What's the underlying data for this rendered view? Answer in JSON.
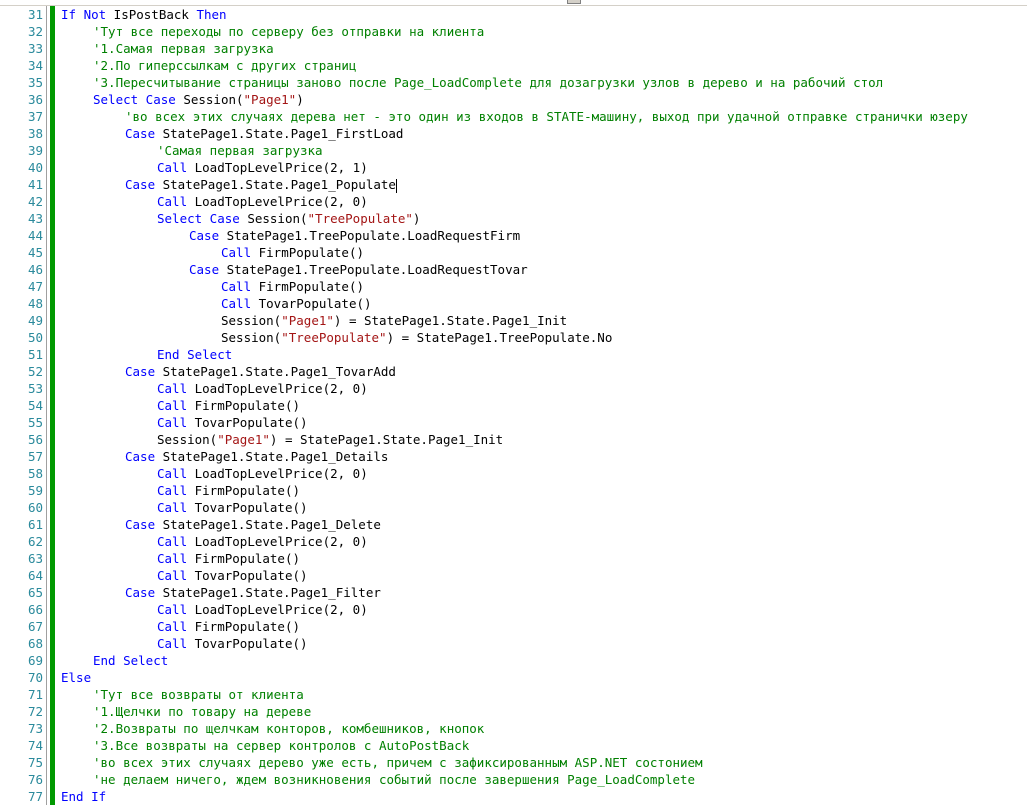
{
  "editor": {
    "lines": [
      {
        "n": "31",
        "indent": 0,
        "tokens": [
          {
            "t": "kw",
            "v": "If Not"
          },
          {
            "t": "tx",
            "v": " IsPostBack "
          },
          {
            "t": "kw",
            "v": "Then"
          }
        ]
      },
      {
        "n": "32",
        "indent": 1,
        "tokens": [
          {
            "t": "cm",
            "v": "'Тут все переходы по серверу без отправки на клиента"
          }
        ]
      },
      {
        "n": "33",
        "indent": 1,
        "tokens": [
          {
            "t": "cm",
            "v": "'1.Самая первая загрузка"
          }
        ]
      },
      {
        "n": "34",
        "indent": 1,
        "tokens": [
          {
            "t": "cm",
            "v": "'2.По гиперссылкам с других страниц"
          }
        ]
      },
      {
        "n": "35",
        "indent": 1,
        "tokens": [
          {
            "t": "cm",
            "v": "'3.Пересчитывание страницы заново после Page_LoadComplete для дозагрузки узлов в дерево и на рабочий стол"
          }
        ]
      },
      {
        "n": "36",
        "indent": 1,
        "tokens": [
          {
            "t": "kw",
            "v": "Select Case"
          },
          {
            "t": "tx",
            "v": " Session("
          },
          {
            "t": "str",
            "v": "\"Page1\""
          },
          {
            "t": "tx",
            "v": ")"
          }
        ]
      },
      {
        "n": "37",
        "indent": 2,
        "tokens": [
          {
            "t": "cm",
            "v": "'во всех этих случаях дерева нет - это один из входов в STATE-машину, выход при удачной отправке странички юзеру"
          }
        ]
      },
      {
        "n": "38",
        "indent": 2,
        "tokens": [
          {
            "t": "kw",
            "v": "Case"
          },
          {
            "t": "tx",
            "v": " StatePage1.State.Page1_FirstLoad"
          }
        ]
      },
      {
        "n": "39",
        "indent": 3,
        "tokens": [
          {
            "t": "cm",
            "v": "'Самая первая загрузка"
          }
        ]
      },
      {
        "n": "40",
        "indent": 3,
        "tokens": [
          {
            "t": "kw",
            "v": "Call"
          },
          {
            "t": "tx",
            "v": " LoadTopLevelPrice(2, 1)"
          }
        ]
      },
      {
        "n": "41",
        "indent": 2,
        "caret": true,
        "tokens": [
          {
            "t": "kw",
            "v": "Case"
          },
          {
            "t": "tx",
            "v": " StatePage1.State.Page1_Populate"
          }
        ]
      },
      {
        "n": "42",
        "indent": 3,
        "tokens": [
          {
            "t": "kw",
            "v": "Call"
          },
          {
            "t": "tx",
            "v": " LoadTopLevelPrice(2, 0)"
          }
        ]
      },
      {
        "n": "43",
        "indent": 3,
        "tokens": [
          {
            "t": "kw",
            "v": "Select Case"
          },
          {
            "t": "tx",
            "v": " Session("
          },
          {
            "t": "str",
            "v": "\"TreePopulate\""
          },
          {
            "t": "tx",
            "v": ")"
          }
        ]
      },
      {
        "n": "44",
        "indent": 4,
        "tokens": [
          {
            "t": "kw",
            "v": "Case"
          },
          {
            "t": "tx",
            "v": " StatePage1.TreePopulate.LoadRequestFirm"
          }
        ]
      },
      {
        "n": "45",
        "indent": 5,
        "tokens": [
          {
            "t": "kw",
            "v": "Call"
          },
          {
            "t": "tx",
            "v": " FirmPopulate()"
          }
        ]
      },
      {
        "n": "46",
        "indent": 4,
        "tokens": [
          {
            "t": "kw",
            "v": "Case"
          },
          {
            "t": "tx",
            "v": " StatePage1.TreePopulate.LoadRequestTovar"
          }
        ]
      },
      {
        "n": "47",
        "indent": 5,
        "tokens": [
          {
            "t": "kw",
            "v": "Call"
          },
          {
            "t": "tx",
            "v": " FirmPopulate()"
          }
        ]
      },
      {
        "n": "48",
        "indent": 5,
        "tokens": [
          {
            "t": "kw",
            "v": "Call"
          },
          {
            "t": "tx",
            "v": " TovarPopulate()"
          }
        ]
      },
      {
        "n": "49",
        "indent": 5,
        "tokens": [
          {
            "t": "tx",
            "v": "Session("
          },
          {
            "t": "str",
            "v": "\"Page1\""
          },
          {
            "t": "tx",
            "v": ") = StatePage1.State.Page1_Init"
          }
        ]
      },
      {
        "n": "50",
        "indent": 5,
        "tokens": [
          {
            "t": "tx",
            "v": "Session("
          },
          {
            "t": "str",
            "v": "\"TreePopulate\""
          },
          {
            "t": "tx",
            "v": ") = StatePage1.TreePopulate.No"
          }
        ]
      },
      {
        "n": "51",
        "indent": 3,
        "tokens": [
          {
            "t": "kw",
            "v": "End Select"
          }
        ]
      },
      {
        "n": "52",
        "indent": 2,
        "tokens": [
          {
            "t": "kw",
            "v": "Case"
          },
          {
            "t": "tx",
            "v": " StatePage1.State.Page1_TovarAdd"
          }
        ]
      },
      {
        "n": "53",
        "indent": 3,
        "tokens": [
          {
            "t": "kw",
            "v": "Call"
          },
          {
            "t": "tx",
            "v": " LoadTopLevelPrice(2, 0)"
          }
        ]
      },
      {
        "n": "54",
        "indent": 3,
        "tokens": [
          {
            "t": "kw",
            "v": "Call"
          },
          {
            "t": "tx",
            "v": " FirmPopulate()"
          }
        ]
      },
      {
        "n": "55",
        "indent": 3,
        "tokens": [
          {
            "t": "kw",
            "v": "Call"
          },
          {
            "t": "tx",
            "v": " TovarPopulate()"
          }
        ]
      },
      {
        "n": "56",
        "indent": 3,
        "tokens": [
          {
            "t": "tx",
            "v": "Session("
          },
          {
            "t": "str",
            "v": "\"Page1\""
          },
          {
            "t": "tx",
            "v": ") = StatePage1.State.Page1_Init"
          }
        ]
      },
      {
        "n": "57",
        "indent": 2,
        "tokens": [
          {
            "t": "kw",
            "v": "Case"
          },
          {
            "t": "tx",
            "v": " StatePage1.State.Page1_Details"
          }
        ]
      },
      {
        "n": "58",
        "indent": 3,
        "tokens": [
          {
            "t": "kw",
            "v": "Call"
          },
          {
            "t": "tx",
            "v": " LoadTopLevelPrice(2, 0)"
          }
        ]
      },
      {
        "n": "59",
        "indent": 3,
        "tokens": [
          {
            "t": "kw",
            "v": "Call"
          },
          {
            "t": "tx",
            "v": " FirmPopulate()"
          }
        ]
      },
      {
        "n": "60",
        "indent": 3,
        "tokens": [
          {
            "t": "kw",
            "v": "Call"
          },
          {
            "t": "tx",
            "v": " TovarPopulate()"
          }
        ]
      },
      {
        "n": "61",
        "indent": 2,
        "tokens": [
          {
            "t": "kw",
            "v": "Case"
          },
          {
            "t": "tx",
            "v": " StatePage1.State.Page1_Delete"
          }
        ]
      },
      {
        "n": "62",
        "indent": 3,
        "tokens": [
          {
            "t": "kw",
            "v": "Call"
          },
          {
            "t": "tx",
            "v": " LoadTopLevelPrice(2, 0)"
          }
        ]
      },
      {
        "n": "63",
        "indent": 3,
        "tokens": [
          {
            "t": "kw",
            "v": "Call"
          },
          {
            "t": "tx",
            "v": " FirmPopulate()"
          }
        ]
      },
      {
        "n": "64",
        "indent": 3,
        "tokens": [
          {
            "t": "kw",
            "v": "Call"
          },
          {
            "t": "tx",
            "v": " TovarPopulate()"
          }
        ]
      },
      {
        "n": "65",
        "indent": 2,
        "tokens": [
          {
            "t": "kw",
            "v": "Case"
          },
          {
            "t": "tx",
            "v": " StatePage1.State.Page1_Filter"
          }
        ]
      },
      {
        "n": "66",
        "indent": 3,
        "tokens": [
          {
            "t": "kw",
            "v": "Call"
          },
          {
            "t": "tx",
            "v": " LoadTopLevelPrice(2, 0)"
          }
        ]
      },
      {
        "n": "67",
        "indent": 3,
        "tokens": [
          {
            "t": "kw",
            "v": "Call"
          },
          {
            "t": "tx",
            "v": " FirmPopulate()"
          }
        ]
      },
      {
        "n": "68",
        "indent": 3,
        "tokens": [
          {
            "t": "kw",
            "v": "Call"
          },
          {
            "t": "tx",
            "v": " TovarPopulate()"
          }
        ]
      },
      {
        "n": "69",
        "indent": 1,
        "tokens": [
          {
            "t": "kw",
            "v": "End Select"
          }
        ]
      },
      {
        "n": "70",
        "indent": 0,
        "tokens": [
          {
            "t": "kw",
            "v": "Else"
          }
        ]
      },
      {
        "n": "71",
        "indent": 1,
        "tokens": [
          {
            "t": "cm",
            "v": "'Тут все возвраты от клиента"
          }
        ]
      },
      {
        "n": "72",
        "indent": 1,
        "tokens": [
          {
            "t": "cm",
            "v": "'1.Щелчки по товару на дереве"
          }
        ]
      },
      {
        "n": "73",
        "indent": 1,
        "tokens": [
          {
            "t": "cm",
            "v": "'2.Возвраты по щелчкам конторов, комбешников, кнопок"
          }
        ]
      },
      {
        "n": "74",
        "indent": 1,
        "tokens": [
          {
            "t": "cm",
            "v": "'3.Все возвраты на сервер контролов с AutoPostBack"
          }
        ]
      },
      {
        "n": "75",
        "indent": 1,
        "tokens": [
          {
            "t": "cm",
            "v": "'во всех этих случаях дерево уже есть, причем с зафиксированным ASP.NET состонием"
          }
        ]
      },
      {
        "n": "76",
        "indent": 1,
        "tokens": [
          {
            "t": "cm",
            "v": "'не делаем ничего, ждем возникновения событий после завершения Page_LoadComplete"
          }
        ]
      },
      {
        "n": "77",
        "indent": 0,
        "tokens": [
          {
            "t": "kw",
            "v": "End If"
          }
        ]
      }
    ]
  },
  "colors": {
    "keyword": "#0000ff",
    "string": "#a31515",
    "comment": "#008000",
    "line_number": "#2b8a9c",
    "change_marker": "#009900"
  }
}
